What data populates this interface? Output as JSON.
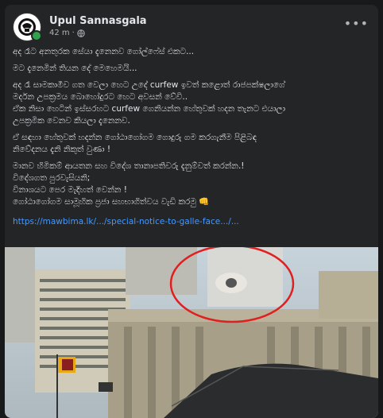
{
  "post": {
    "author": "Upul Sannasgala",
    "time": "42 m",
    "separator": "·",
    "privacy_icon": "globe-icon",
    "more_icon": "more-options-icon"
  },
  "content": {
    "line1": "අද රෑට අනතුරක සේයා දැනෙනව ගෝල්ෆේස් එකට...",
    "line2": "මට දැනෙමින් තියන දේ මෙහෙමයි...",
    "para1_l1": "අද රෑ සාමකාමීව ගත වෙලා හෙට උදේ curfew ඉවත් කළොත් රාජපක්ෂලාගේ",
    "para1_l2": "මර්දන උපක්‍රමය බොහෝදුරට හෙට අවසන් වේවි..",
    "para1_l3": "ඒක නිසා හෙටින් ඉස්සරහට curfew ගෙනියන්න හේතුවක් හදන තැනට එයාලා",
    "para1_l4": "උපක්‍රමික වෙනව කියලා දැනෙනව.",
    "para2_l1": "ඒ සඳහා හේතුවක් හදන්න ගෝඨාගෝගම ගොදුරු ගම කරගැනීම පිළිබඳ",
    "para2_l2": "නිවේදනය දැනි නිකුත් වුණා !",
    "para3_l1": "මානව හිමිකම් ආයතන සහ විදේශ තානාපතිවරු දැනුම්වත් කරන්න.!",
    "para3_l2": "විදේශගත පුරවැසියනි;",
    "para3_l3": "විනාශයට පෙර මැදිහත් වෙන්න !",
    "para3_l4": "ගෝඨාගෝගම සාමූහික ප්‍රජා සහභාගිත්වය වැඩි කරමු",
    "fist_emoji": "👊",
    "link": "https://mawbima.lk/.../special-notice-to-galle-face.../..."
  },
  "photo": {
    "description_icon": "news-photo-image"
  },
  "colors": {
    "background": "#18191a",
    "card": "#242526",
    "text": "#e4e6eb",
    "muted": "#b0b3b8",
    "link": "#4599ff",
    "highlight_circle": "#e02020"
  }
}
